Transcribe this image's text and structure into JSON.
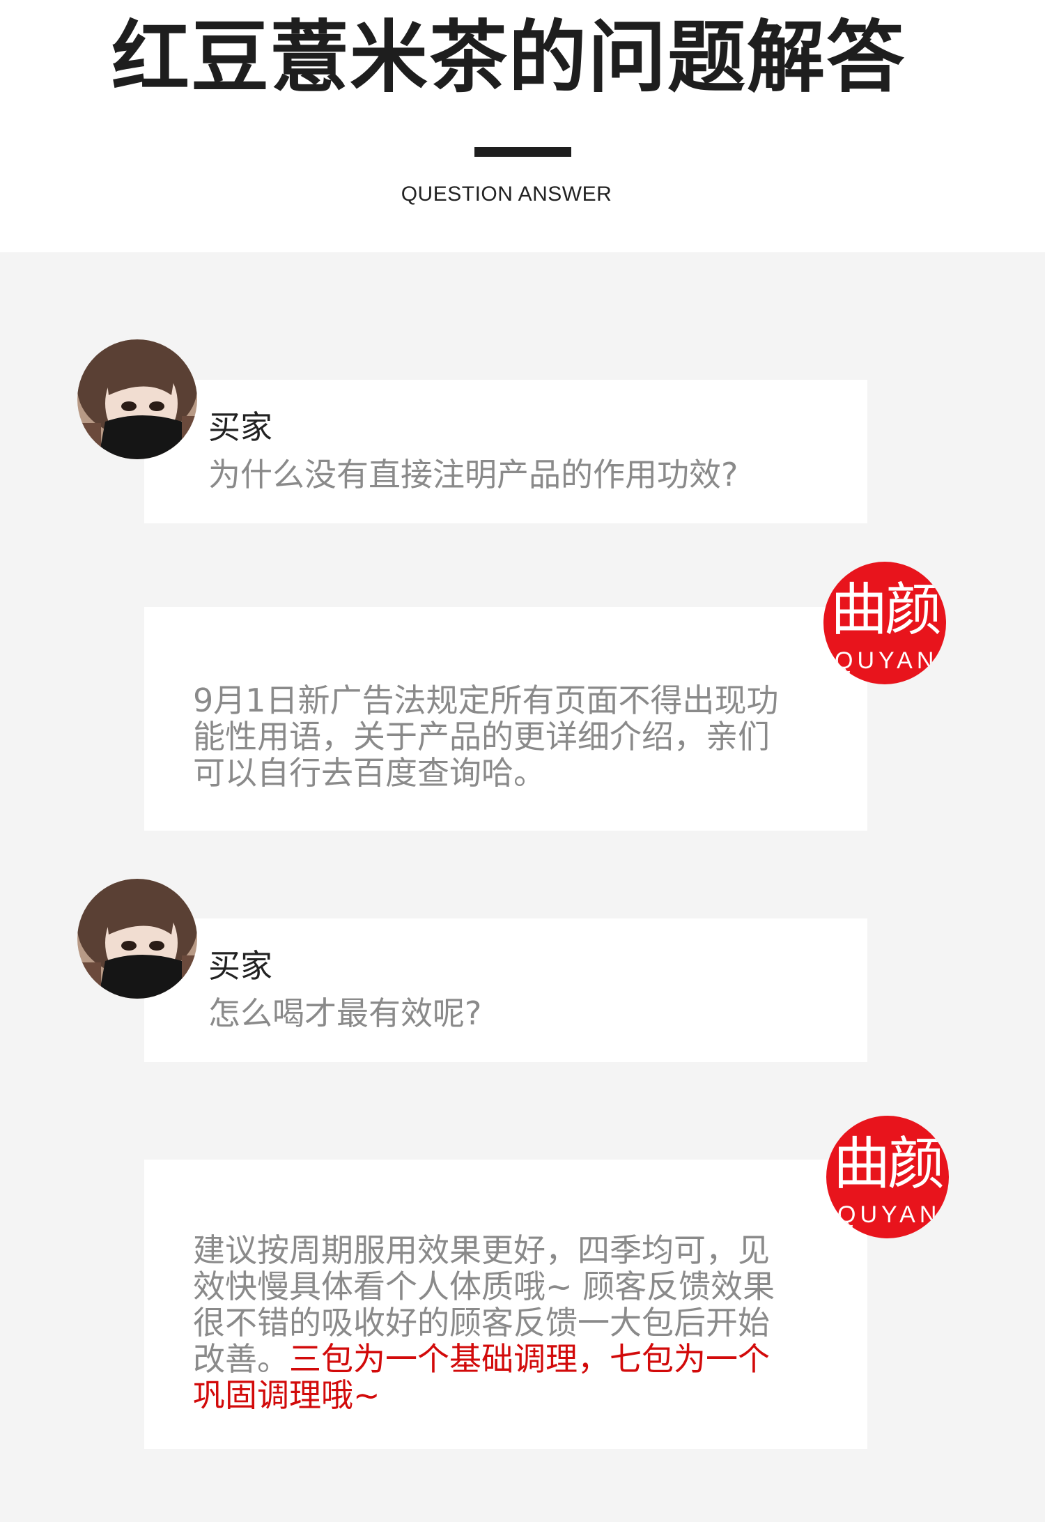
{
  "header": {
    "title": "红豆薏米茶的问题解答",
    "subtitle": "QUESTION ANSWER"
  },
  "brand": {
    "logo_cn": "曲颜",
    "logo_en": "QUYAN",
    "color": "#e8141c"
  },
  "qa": [
    {
      "asker": "买家",
      "question": "为什么没有直接注明产品的作用功效?",
      "answer_lines": [
        "9月1日新广告法规定所有页面不得出现功",
        "能性用语，关于产品的更详细介绍，亲们",
        "可以自行去百度查询哈。"
      ]
    },
    {
      "asker": "买家",
      "question": "怎么喝才最有效呢?",
      "answer_lines": [
        "建议按周期服用效果更好，四季均可，见",
        "效快慢具体看个人体质哦~ 顾客反馈效果",
        "很不错的吸收好的顾客反馈一大包后开始"
      ],
      "answer_line4_plain": "改善。",
      "answer_line4_highlight": "三包为一个基础调理，七包为一个",
      "answer_line5_highlight": "巩固调理哦~",
      "highlight_color": "#d20a0a"
    }
  ]
}
